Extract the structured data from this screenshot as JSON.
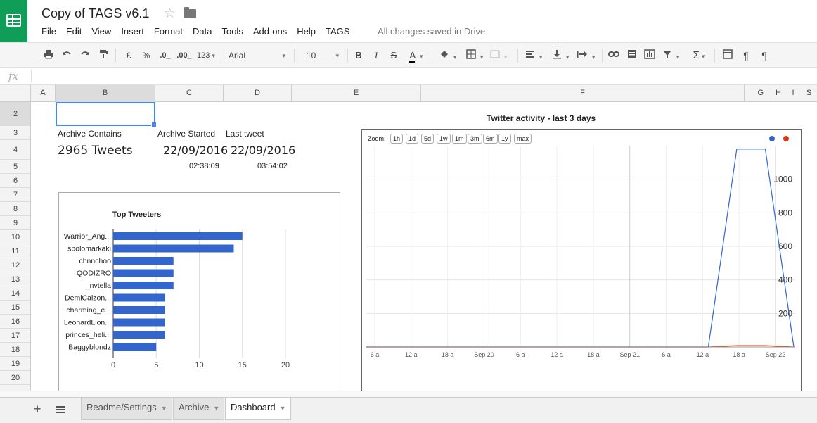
{
  "app": {
    "title": "Copy of TAGS v6.1",
    "save_status": "All changes saved in Drive",
    "menu": [
      "File",
      "Edit",
      "View",
      "Insert",
      "Format",
      "Data",
      "Tools",
      "Add-ons",
      "Help",
      "TAGS"
    ]
  },
  "toolbar": {
    "currency": "£",
    "percent": "%",
    "dec_less": ".0_",
    "dec_more": ".00_",
    "more_formats": "123",
    "font": "Arial",
    "font_size": "10",
    "bold": "B",
    "italic": "I",
    "strike": "S",
    "text_color": "A"
  },
  "formula_bar": {
    "icon": "fx",
    "value": ""
  },
  "columns": [
    "A",
    "B",
    "C",
    "D",
    "E",
    "F",
    "G",
    "H",
    "I",
    "S"
  ],
  "rows": [
    "2",
    "3",
    "4",
    "5",
    "6",
    "7",
    "8",
    "9",
    "10",
    "11",
    "12",
    "13",
    "14",
    "15",
    "16",
    "17",
    "18",
    "19",
    "20"
  ],
  "dashboard": {
    "archive_contains_label": "Archive Contains",
    "archive_started_label": "Archive Started",
    "last_tweet_label": "Last tweet",
    "tweet_count": "2965 Tweets",
    "started_date": "22/09/2016",
    "started_time": "02:38:09",
    "last_date": "22/09/2016",
    "last_time": "03:54:02"
  },
  "bar_chart_data": {
    "type": "bar",
    "title": "Top Tweeters",
    "categories": [
      "Warrior_Ang...",
      "spolomarkaki",
      "chnnchoo",
      "QODIZRO",
      "_nvtella",
      "DemiCalzon...",
      "charming_e...",
      "LeonardLion...",
      "princes_heli...",
      "Baggyblondz"
    ],
    "values": [
      15,
      14,
      7,
      7,
      7,
      6,
      6,
      6,
      6,
      5
    ],
    "xlim": [
      0,
      20
    ],
    "ticks": [
      "0",
      "5",
      "10",
      "15",
      "20"
    ],
    "color": "#3366cc"
  },
  "chart_data": {
    "type": "line",
    "title": "Twitter activity - last 3 days",
    "zoom_label": "Zoom:",
    "zoom_buttons": [
      "1h",
      "1d",
      "5d",
      "1w",
      "1m",
      "3m",
      "6m",
      "1y",
      "max"
    ],
    "x_ticks": [
      "6 a",
      "12 a",
      "18 a",
      "Sep 20",
      "6 a",
      "12 a",
      "18 a",
      "Sep 21",
      "6 a",
      "12 a",
      "18 a",
      "Sep 22"
    ],
    "y_ticks": [
      "200",
      "400",
      "600",
      "800",
      "1000"
    ],
    "ylim": [
      0,
      1200
    ],
    "series": [
      {
        "color": "#3366cc",
        "values": [
          0,
          0,
          0,
          0,
          0,
          0,
          0,
          0,
          0,
          0,
          0,
          0,
          0,
          1180,
          1180,
          0
        ]
      },
      {
        "color": "#dc3912",
        "values": [
          0,
          0,
          0,
          0,
          0,
          0,
          0,
          0,
          0,
          0,
          0,
          0,
          0,
          8,
          8,
          0
        ]
      }
    ]
  },
  "sheet_tabs": [
    {
      "label": "Readme/Settings",
      "active": false
    },
    {
      "label": "Archive",
      "active": false
    },
    {
      "label": "Dashboard",
      "active": true
    }
  ]
}
